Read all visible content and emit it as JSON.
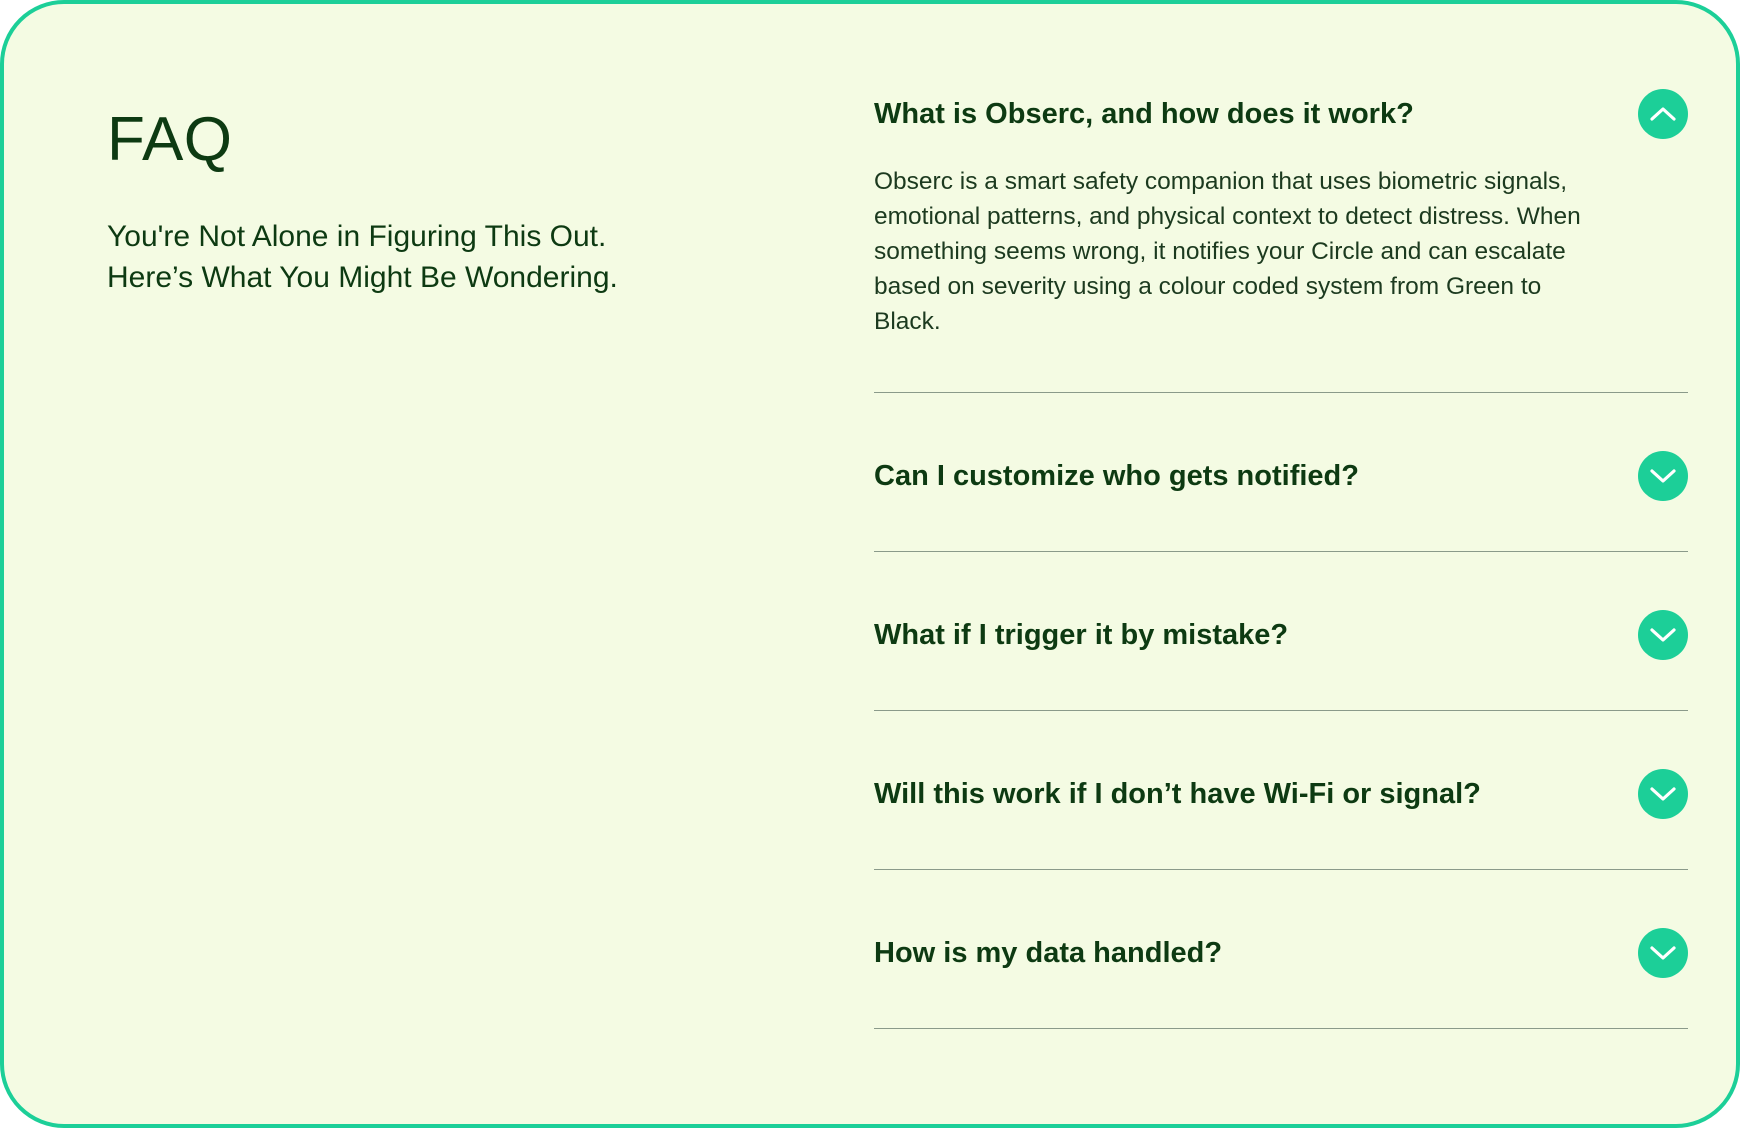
{
  "intro": {
    "title": "FAQ",
    "subtitle_line1": "You're Not Alone in Figuring This Out.",
    "subtitle_line2": "Here’s What You Might Be Wondering."
  },
  "faq": {
    "items": [
      {
        "question": "What is Obserc, and how does it work?",
        "answer": "Obserc is a smart safety companion that uses biometric signals, emotional patterns, and physical context to detect distress. When something seems wrong, it notifies your Circle and can escalate based on severity using a colour coded system from Green to Black.",
        "expanded": true,
        "icon": "chevron-up-icon"
      },
      {
        "question": "Can I customize who gets notified?",
        "expanded": false,
        "icon": "chevron-down-icon"
      },
      {
        "question": "What if I trigger it by mistake?",
        "expanded": false,
        "icon": "chevron-down-icon"
      },
      {
        "question": "Will this work if I don’t have Wi-Fi or signal?",
        "expanded": false,
        "icon": "chevron-down-icon"
      },
      {
        "question": "How is my data handled?",
        "expanded": false,
        "icon": "chevron-down-icon"
      }
    ]
  },
  "colors": {
    "accent": "#1ccf98",
    "background": "#f4fbe3",
    "text": "#0d3a12",
    "divider": "#8a9a8a"
  }
}
